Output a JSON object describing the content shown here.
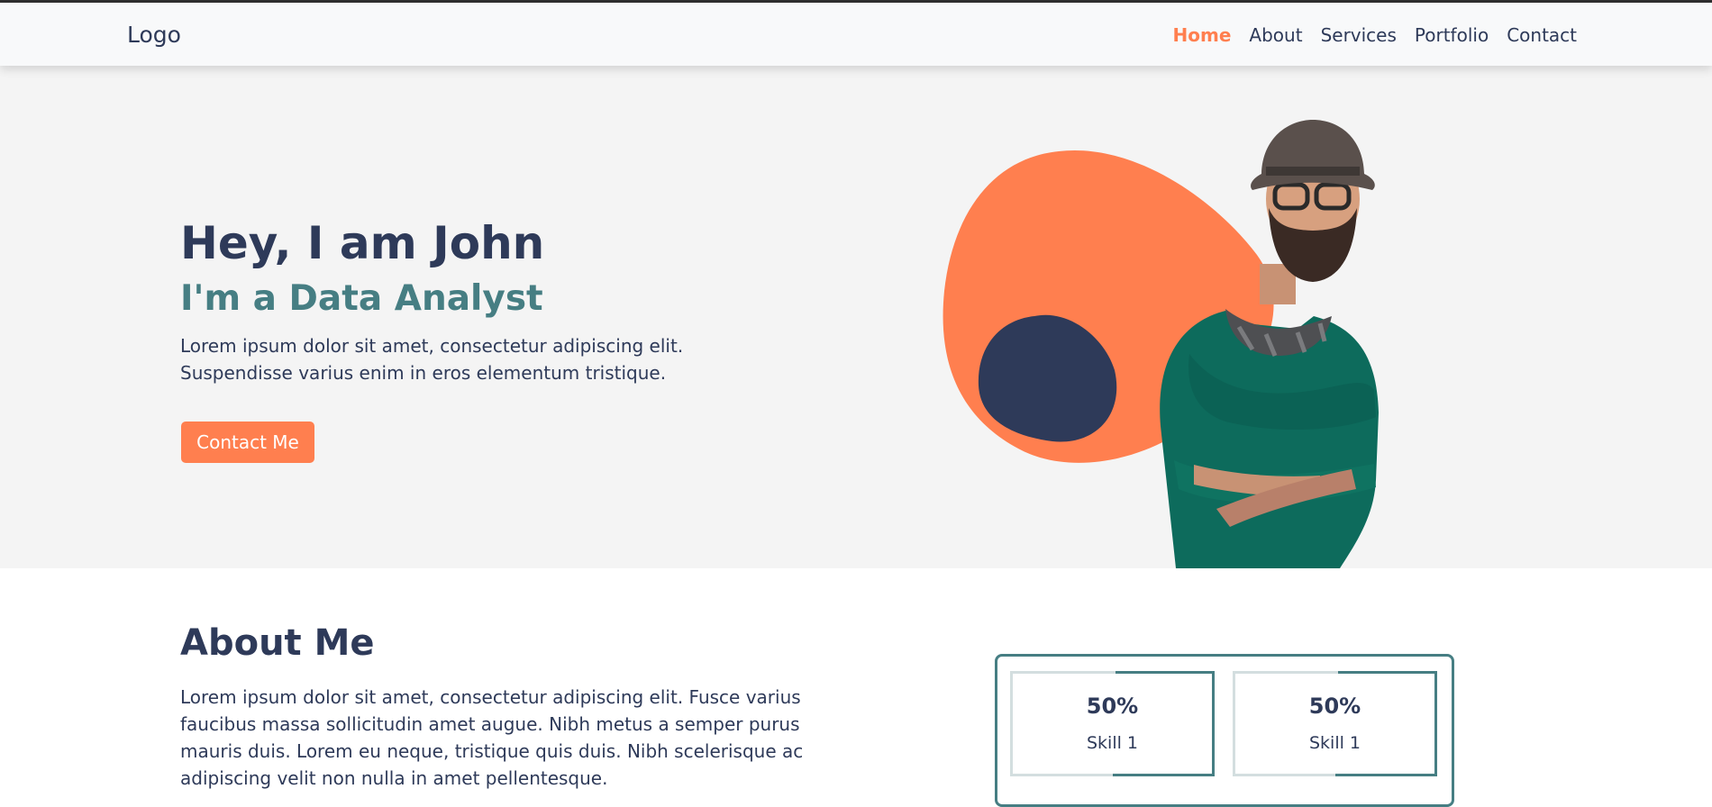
{
  "nav": {
    "logo": "Logo",
    "links": [
      {
        "label": "Home",
        "active": true
      },
      {
        "label": "About",
        "active": false
      },
      {
        "label": "Services",
        "active": false
      },
      {
        "label": "Portfolio",
        "active": false
      },
      {
        "label": "Contact",
        "active": false
      }
    ]
  },
  "hero": {
    "title": "Hey, I am John",
    "subtitle": "I'm a Data Analyst",
    "description_line1": "Lorem ipsum dolor sit amet, consectetur adipiscing elit.",
    "description_line2": "Suspendisse varius enim in eros elementum tristique.",
    "button_label": "Contact Me"
  },
  "about": {
    "title": "About Me",
    "text": "Lorem ipsum dolor sit amet, consectetur adipiscing elit. Fusce varius faucibus massa sollicitudin amet augue. Nibh metus a semper purus mauris duis. Lorem eu neque, tristique quis duis. Nibh scelerisque ac adipiscing velit non nulla in amet pellentesque.",
    "skills": [
      {
        "percent": "50%",
        "name": "Skill 1"
      },
      {
        "percent": "50%",
        "name": "Skill 1"
      }
    ]
  },
  "colors": {
    "accent": "#ff7f4f",
    "navy": "#2e3a59",
    "teal": "#467e83",
    "sweater": "#0d6b5c"
  }
}
